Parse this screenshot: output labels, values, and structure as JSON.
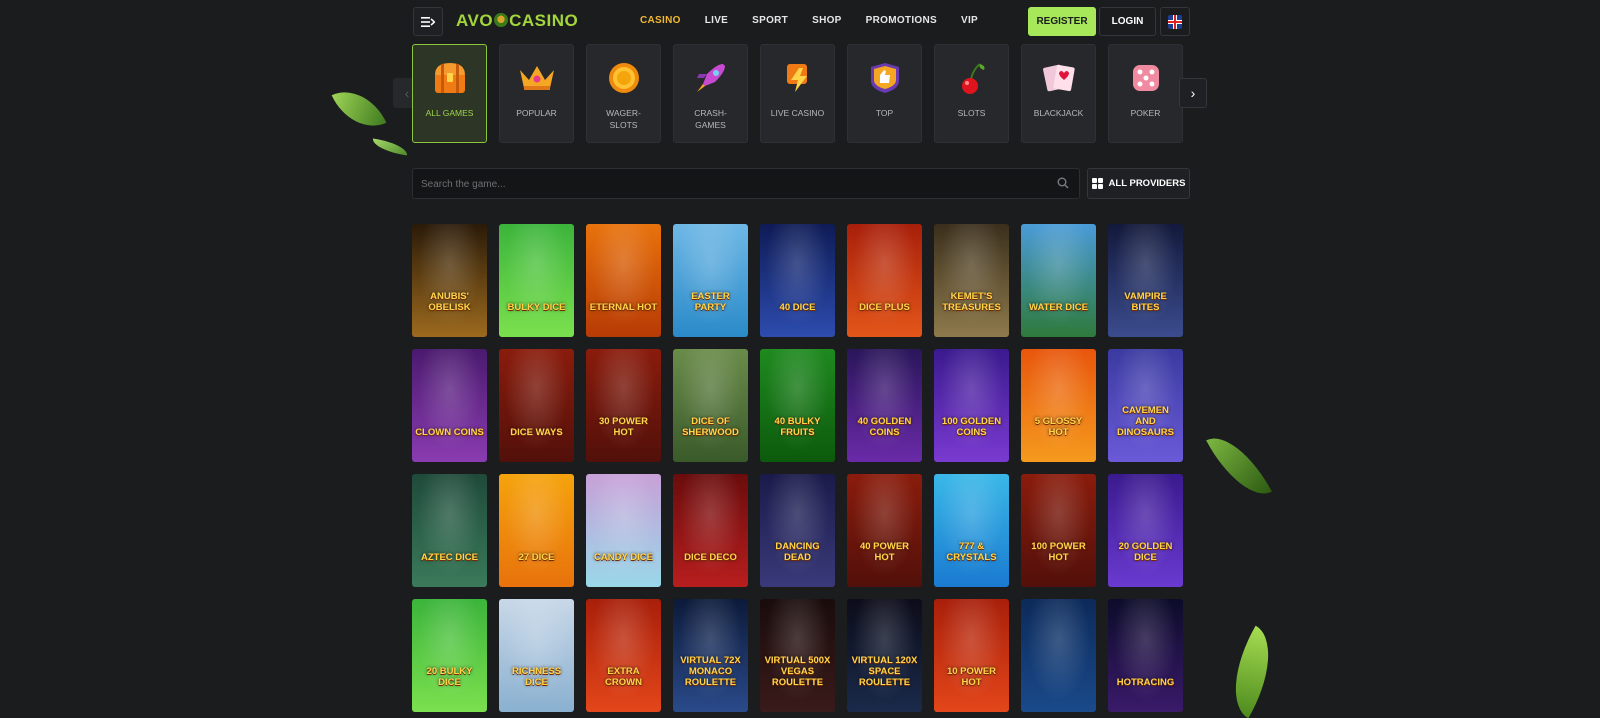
{
  "header": {
    "logo": "AVOCASINO",
    "logo_left": "AVO",
    "logo_right": "CASINO",
    "nav": [
      "CASINO",
      "LIVE",
      "SPORT",
      "SHOP",
      "PROMOTIONS",
      "VIP"
    ],
    "register_label": "REGISTER",
    "login_label": "LOGIN"
  },
  "categories": [
    {
      "label": "ALL GAMES",
      "icon": "treasure-chest-icon",
      "active": true
    },
    {
      "label": "POPULAR",
      "icon": "crown-icon"
    },
    {
      "label": "WAGER-\nSLOTS",
      "icon": "coin-icon"
    },
    {
      "label": "CRASH-\nGAMES",
      "icon": "rocket-icon"
    },
    {
      "label": "LIVE CASINO",
      "icon": "lightning-icon"
    },
    {
      "label": "TOP",
      "icon": "thumbs-up-badge-icon"
    },
    {
      "label": "SLOTS",
      "icon": "cherry-icon"
    },
    {
      "label": "BLACKJACK",
      "icon": "cards-icon"
    },
    {
      "label": "POKER",
      "icon": "dice-icon"
    }
  ],
  "search": {
    "placeholder": "Search the game..."
  },
  "providers_label": "ALL PROVIDERS",
  "games": [
    {
      "title": "ANUBIS' OBELISK",
      "colors": [
        "#2a1a08",
        "#9c6a1e"
      ]
    },
    {
      "title": "BULKY DICE",
      "colors": [
        "#3bb43b",
        "#7be04e"
      ]
    },
    {
      "title": "ETERNAL HOT",
      "colors": [
        "#e8720c",
        "#b73b05"
      ]
    },
    {
      "title": "EASTER PARTY",
      "colors": [
        "#6fb8e6",
        "#2a8ac8"
      ]
    },
    {
      "title": "40 DICE",
      "colors": [
        "#0e1b56",
        "#2d4cae"
      ]
    },
    {
      "title": "DICE PLUS",
      "colors": [
        "#a81f0a",
        "#e3561a"
      ]
    },
    {
      "title": "KEMET'S TREASURES",
      "colors": [
        "#3b2f1c",
        "#8e7a4c"
      ]
    },
    {
      "title": "WATER DICE",
      "colors": [
        "#4a9bd8",
        "#2f7a3c"
      ]
    },
    {
      "title": "VAMPIRE BITES",
      "colors": [
        "#12193b",
        "#3b4c8e"
      ]
    },
    {
      "title": "CLOWN COINS",
      "colors": [
        "#4a1a6e",
        "#8a3cb0"
      ]
    },
    {
      "title": "DICE WAYS",
      "colors": [
        "#8a1c0c",
        "#52100a"
      ]
    },
    {
      "title": "30 POWER HOT",
      "colors": [
        "#8a1c0c",
        "#52100a"
      ]
    },
    {
      "title": "DICE OF SHERWOOD",
      "colors": [
        "#6a8c4a",
        "#3a5a2a"
      ]
    },
    {
      "title": "40 BULKY FRUITS",
      "colors": [
        "#1f8a1f",
        "#0c5a0c"
      ]
    },
    {
      "title": "40 GOLDEN COINS",
      "colors": [
        "#2a165a",
        "#6a2aa8"
      ]
    },
    {
      "title": "100 GOLDEN COINS",
      "colors": [
        "#3a1a8e",
        "#7a3ad0"
      ]
    },
    {
      "title": "5 GLOSSY HOT",
      "colors": [
        "#e8560c",
        "#f59a1e"
      ]
    },
    {
      "title": "CAVEMEN AND DINOSAURS",
      "colors": [
        "#3a3aa0",
        "#6a5ad8"
      ]
    },
    {
      "title": "AZTEC DICE",
      "colors": [
        "#1f4a3a",
        "#3a7a5a"
      ]
    },
    {
      "title": "27 DICE",
      "colors": [
        "#f5a30c",
        "#e8720c"
      ]
    },
    {
      "title": "CANDY DICE",
      "colors": [
        "#c8a0d8",
        "#9ad8e8"
      ]
    },
    {
      "title": "DICE DECO",
      "colors": [
        "#6a0c0c",
        "#b81e1e"
      ]
    },
    {
      "title": "DANCING DEAD",
      "colors": [
        "#1a1a4a",
        "#3a3a7a"
      ]
    },
    {
      "title": "40 POWER HOT",
      "colors": [
        "#8a1c0c",
        "#52100a"
      ]
    },
    {
      "title": "777 & CRYSTALS",
      "colors": [
        "#3ab8e8",
        "#1a7ad0"
      ]
    },
    {
      "title": "100 POWER HOT",
      "colors": [
        "#8a1c0c",
        "#52100a"
      ]
    },
    {
      "title": "20 GOLDEN DICE",
      "colors": [
        "#3a1a8e",
        "#6a3ad0"
      ]
    },
    {
      "title": "20 BULKY DICE",
      "colors": [
        "#3bb43b",
        "#7be04e"
      ]
    },
    {
      "title": "RICHNESS DICE",
      "colors": [
        "#c8d8e8",
        "#8ab0d0"
      ]
    },
    {
      "title": "EXTRA CROWN",
      "colors": [
        "#a81f0a",
        "#e3461a"
      ]
    },
    {
      "title": "VIRTUAL 72X MONACO ROULETTE",
      "colors": [
        "#0c1a3a",
        "#2a4a8a"
      ]
    },
    {
      "title": "VIRTUAL 500X VEGAS ROULETTE",
      "colors": [
        "#1a0c0c",
        "#3a1a1a"
      ]
    },
    {
      "title": "VIRTUAL 120X SPACE ROULETTE",
      "colors": [
        "#0c0c1a",
        "#1a2a4a"
      ]
    },
    {
      "title": "10 POWER HOT",
      "colors": [
        "#a81f0a",
        "#e3461a"
      ]
    },
    {
      "title": "",
      "colors": [
        "#0c2a5a",
        "#1a4a8a"
      ]
    },
    {
      "title": "HOTRACING",
      "colors": [
        "#0c0c2a",
        "#3a1a6a"
      ]
    }
  ]
}
